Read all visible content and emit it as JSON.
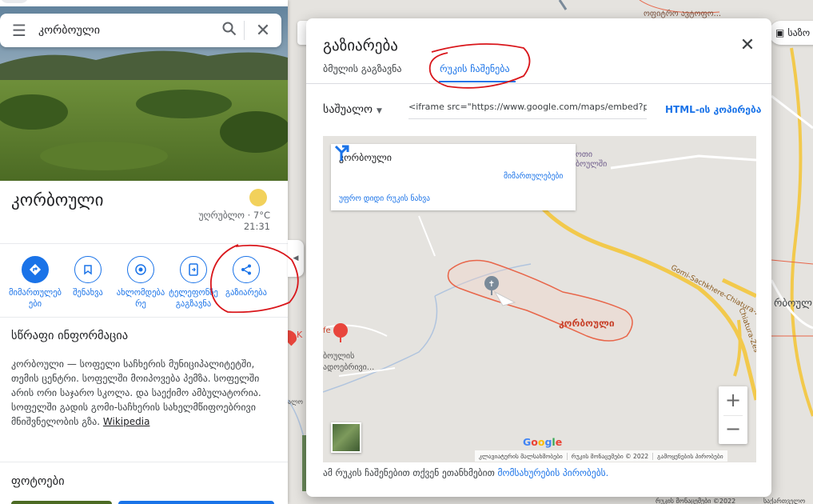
{
  "search": {
    "query": "კორბოული",
    "menu_icon": "menu-icon",
    "search_icon": "search-icon",
    "close_icon": "close-icon"
  },
  "place": {
    "title": "კორბოული",
    "weather_line": "უღრუბლო · 7°C",
    "time": "21:31"
  },
  "actions": [
    {
      "label": "მიმართულებები",
      "icon": "directions-icon"
    },
    {
      "label": "შენახვა",
      "icon": "bookmark-icon"
    },
    {
      "label": "ახლომდებარე",
      "icon": "nearby-icon"
    },
    {
      "label": "ტელეფონზე გაგზავნა",
      "icon": "send-to-phone-icon"
    },
    {
      "label": "გაზიარება",
      "icon": "share-icon"
    }
  ],
  "quick_facts": {
    "title": "სწრაფი ინფორმაცია",
    "description": "კორბოული — სოფელი საჩხერის მუნიციპალიტეტში, თემის ცენტრი. სოფელში მოიპოვება პემზა. სოფელში არის ორი საჯარო სკოლა. და საექიმო ამბულატორია. სოფელში გადის გომი-საჩხერის სახელმწიფოებრივი მნიშვნელობის გზა.",
    "source_link": "Wikipedia"
  },
  "photos_title": "ფოტოები",
  "background_map": {
    "right_chip": "საზო",
    "right_label": "რბოულ",
    "top_label": "ოფიტრო ავტოფო...",
    "bottom_attrib": "რუკის მონაცემები ©2022",
    "bottom_attrib_2": "საქართველო",
    "left_label": "ალო",
    "poi_letter": "K"
  },
  "dialog": {
    "title": "გაზიარება",
    "tabs": [
      "ბმულის გაგზავნა",
      "რუკის ჩაშენება"
    ],
    "active_tab": 1,
    "size_label": "საშუალო",
    "iframe_code": "<iframe src=\"https://www.google.com/maps/embed?pb=!",
    "copy_label": "HTML-ის კოპირება",
    "footer_text": "ამ რუკის ჩაშენებით თქვენ ეთანხმებით ",
    "footer_link": "მომსახურების პირობებს."
  },
  "embed": {
    "place_name": "კორბოული",
    "directions_label": "მიმართულებები",
    "larger_map": "უფრო დიდი რუკის ნახვა",
    "area_label": "კორბოული",
    "road_label": "Gomi-Sachkhere-Chiatura-Zestaponi",
    "village_label_top": "ოთი",
    "village_label_top2": "ბოულში",
    "village_label_left": "ბოულის",
    "village_label_left2": "ადოებრივი...",
    "poi_left_label": "fe",
    "road_label_side": "Chiatura-Zes",
    "zoom_in": "+",
    "zoom_out": "−",
    "google": "Google",
    "attribution": [
      "კლავიატურის მალსახმობები",
      "რუკის მონაცემები © 2022",
      "გამოყენების პირობები"
    ]
  },
  "colors": {
    "accent": "#1a73e8",
    "area_outline": "#e8664a",
    "road_yellow": "#f2c94c",
    "annotation_red": "#d9161b"
  }
}
